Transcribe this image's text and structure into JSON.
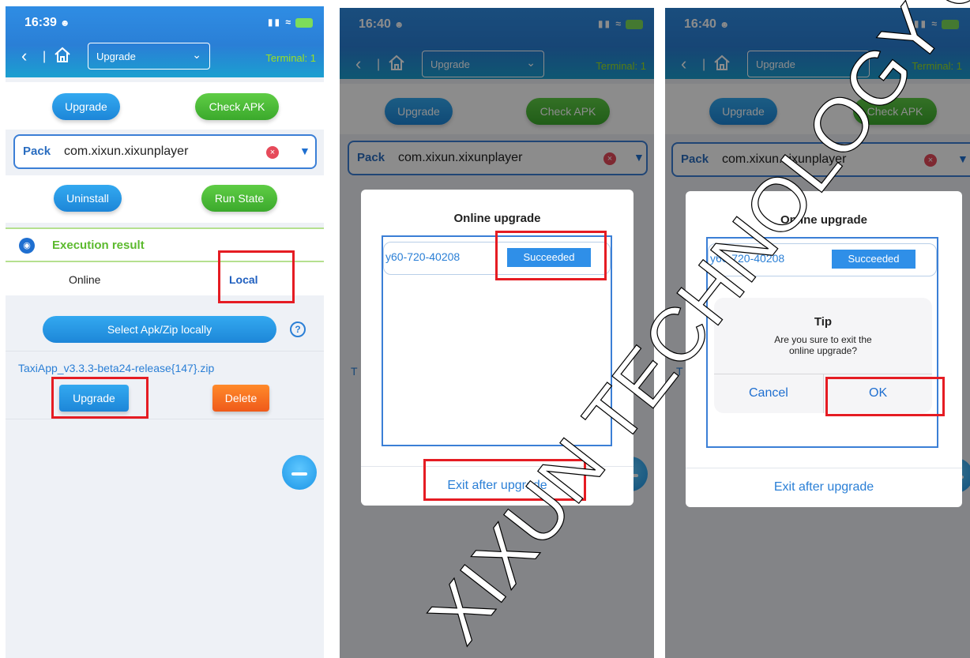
{
  "status": {
    "time_1": "16:39",
    "time_2": "16:40",
    "time_3": "16:40"
  },
  "header": {
    "select_value": "Upgrade",
    "terminal_label": "Terminal: 1"
  },
  "buttons": {
    "upgrade": "Upgrade",
    "check_apk": "Check APK",
    "uninstall": "Uninstall",
    "run_state": "Run State"
  },
  "pack": {
    "label": "Pack",
    "value": "com.xixun.xixunplayer"
  },
  "execution": {
    "title": "Execution result",
    "tab_online": "Online",
    "tab_local": "Local"
  },
  "local": {
    "select_button": "Select Apk/Zip locally",
    "help_icon_glyph": "?",
    "file_name": "TaxiApp_v3.3.3-beta24-release{147}.zip",
    "file_upgrade": "Upgrade",
    "file_delete": "Delete"
  },
  "online_dialog": {
    "title": "Online upgrade",
    "device_id": "y60-720-40208",
    "status": "Succeeded",
    "exit_button": "Exit after upgrade",
    "partial_char": "T"
  },
  "tip_dialog": {
    "title": "Tip",
    "message": "Are you sure to exit the online upgrade?",
    "cancel": "Cancel",
    "ok": "OK"
  },
  "watermark": {
    "text": "XIXUN TECHNOLOGY CO., L"
  },
  "colors": {
    "header_blue": "#2a7fd6",
    "success_green": "#5cba2e",
    "highlight_red": "#e51c23",
    "delete_orange": "#ef5a1a"
  }
}
